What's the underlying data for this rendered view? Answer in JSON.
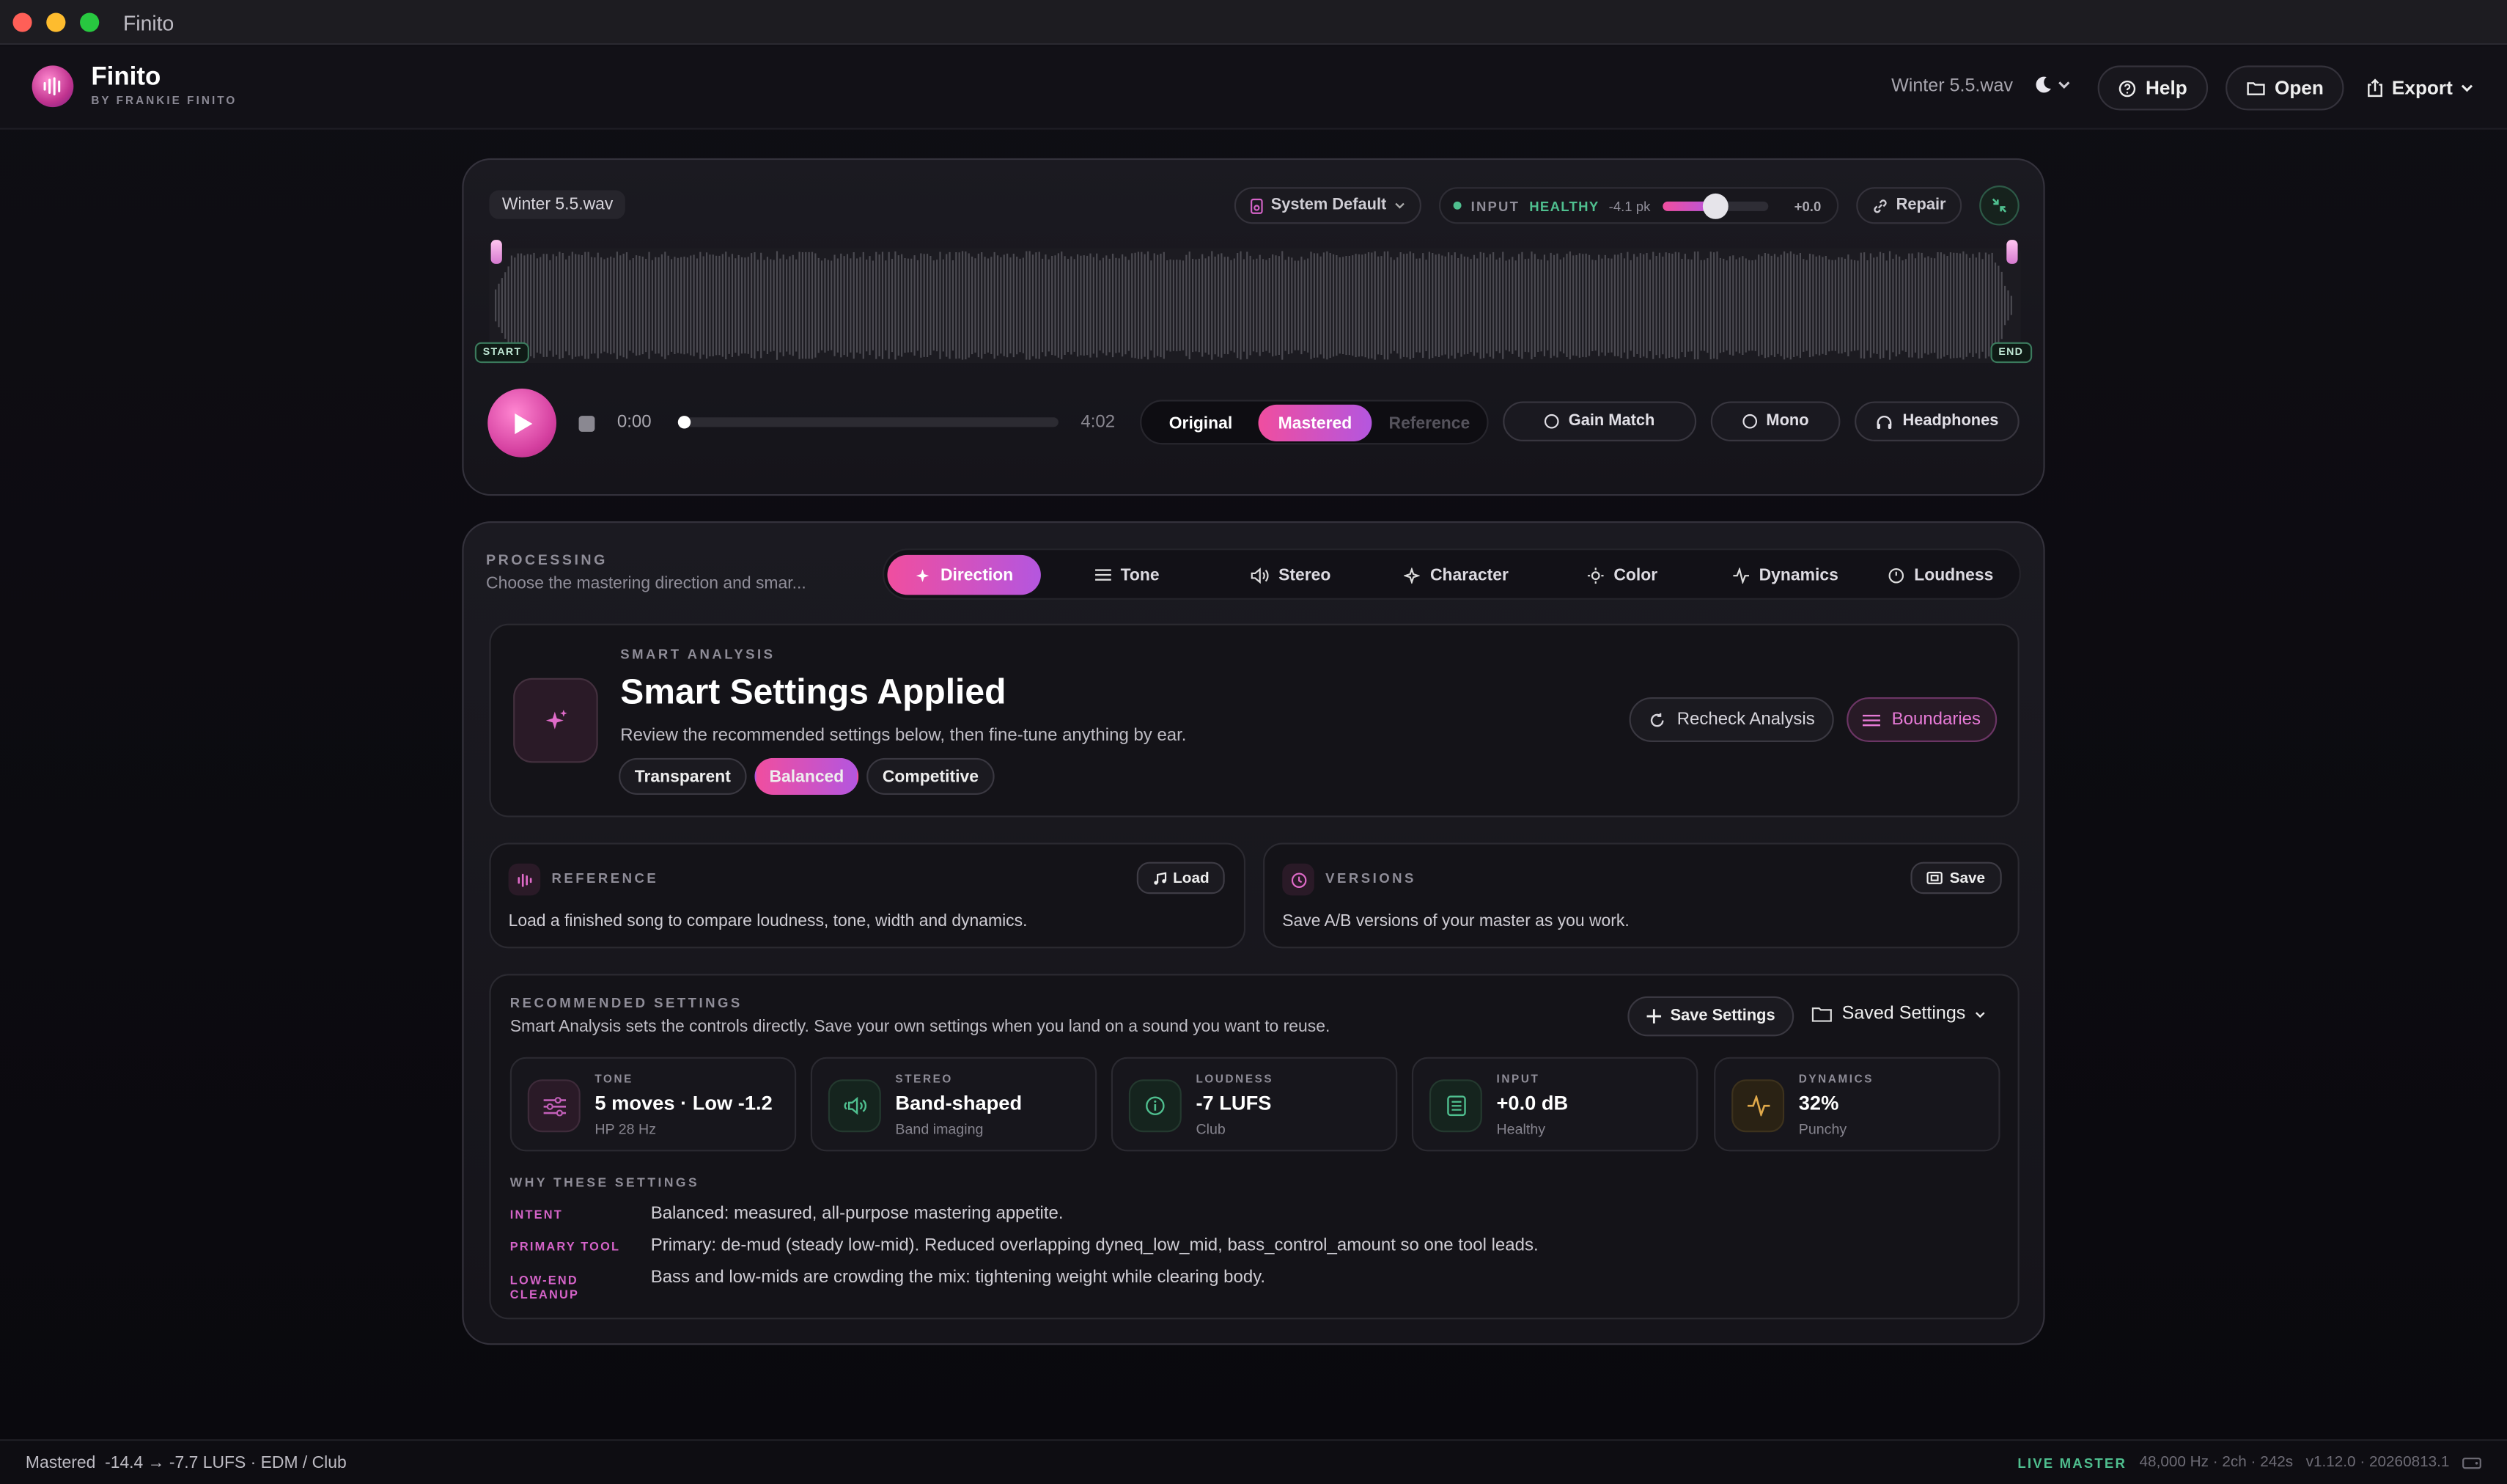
{
  "window": {
    "title": "Finito"
  },
  "header": {
    "brand": "Finito",
    "byline": "BY FRANKIE FINITO",
    "file": "Winter 5.5.wav",
    "help": "Help",
    "open": "Open",
    "export": "Export"
  },
  "player": {
    "file": "Winter 5.5.wav",
    "device": "System Default",
    "input_label": "INPUT",
    "input_status": "HEALTHY",
    "input_peak": "-4.1 pk",
    "input_gain": "+0.0",
    "input_gain_level": 0.5,
    "repair": "Repair",
    "start": "START",
    "end": "END",
    "time_current": "0:00",
    "time_total": "4:02",
    "progress": 0.0,
    "modes": [
      "Original",
      "Mastered",
      "Reference"
    ],
    "selected_mode": "Mastered",
    "gain_match": "Gain Match",
    "mono": "Mono",
    "headphones": "Headphones"
  },
  "processing": {
    "label": "PROCESSING",
    "subtitle": "Choose the mastering direction and smar...",
    "tabs": [
      "Direction",
      "Tone",
      "Stereo",
      "Character",
      "Color",
      "Dynamics",
      "Loudness"
    ],
    "active_tab": "Direction"
  },
  "smart": {
    "label": "SMART ANALYSIS",
    "title": "Smart Settings Applied",
    "desc": "Review the recommended settings below, then fine-tune anything by ear.",
    "presets": [
      "Transparent",
      "Balanced",
      "Competitive"
    ],
    "selected_preset": "Balanced",
    "recheck": "Recheck Analysis",
    "boundaries": "Boundaries"
  },
  "reference": {
    "label": "REFERENCE",
    "load": "Load",
    "desc": "Load a finished song to compare loudness, tone, width and dynamics."
  },
  "versions": {
    "label": "VERSIONS",
    "save": "Save",
    "desc": "Save A/B versions of your master as you work."
  },
  "recommended": {
    "label": "RECOMMENDED SETTINGS",
    "desc": "Smart Analysis sets the controls directly. Save your own settings when you land on a sound you want to reuse.",
    "save_settings": "Save Settings",
    "saved_settings": "Saved Settings",
    "stats": [
      {
        "key": "TONE",
        "value": "5 moves · Low -1.2",
        "sub": "HP 28 Hz",
        "icon": "sliders-icon",
        "color": "#c25fb8"
      },
      {
        "key": "STEREO",
        "value": "Band-shaped",
        "sub": "Band imaging",
        "icon": "speaker-icon",
        "color": "#4fbf8f"
      },
      {
        "key": "LOUDNESS",
        "value": "-7 LUFS",
        "sub": "Club",
        "icon": "info-icon",
        "color": "#4fbf8f"
      },
      {
        "key": "INPUT",
        "value": "+0.0 dB",
        "sub": "Healthy",
        "icon": "meter-icon",
        "color": "#4fbf8f"
      },
      {
        "key": "DYNAMICS",
        "value": "32%",
        "sub": "Punchy",
        "icon": "pulse-icon",
        "color": "#e0a94a"
      }
    ],
    "why_label": "WHY THESE SETTINGS",
    "why": [
      {
        "key": "INTENT",
        "value": "Balanced: measured, all-purpose mastering appetite."
      },
      {
        "key": "PRIMARY TOOL",
        "value": "Primary: de-mud (steady low-mid). Reduced overlapping dyneq_low_mid, bass_control_amount so one tool leads."
      },
      {
        "key": "LOW-END CLEANUP",
        "value": "Bass and low-mids are crowding the mix: tightening weight while clearing body."
      }
    ]
  },
  "status": {
    "left": "Mastered  -14.4 → -7.7 LUFS · EDM / Club",
    "live": "LIVE MASTER",
    "info": "48,000 Hz · 2ch · 242s",
    "version": "v1.12.0 · 20260813.1"
  },
  "colors": {
    "accent": "#f04e9f",
    "accent2": "#b456df",
    "green": "#4fbf8f"
  }
}
